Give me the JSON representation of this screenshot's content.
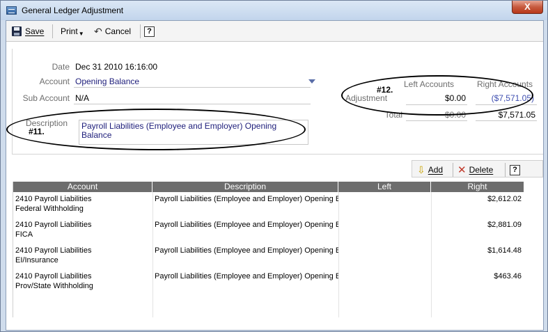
{
  "window": {
    "title": "General Ledger Adjustment",
    "close_glyph": "X"
  },
  "toolbar": {
    "save": "Save",
    "print": "Print",
    "cancel": "Cancel",
    "help": "?"
  },
  "form": {
    "date_label": "Date",
    "date_value": "Dec 31 2010 16:16:00",
    "account_label": "Account",
    "account_value": "Opening Balance",
    "sub_account_label": "Sub Account",
    "sub_account_value": "N/A",
    "description_label": "Description",
    "description_value": "Payroll Liabilities (Employee and Employer) Opening Balance",
    "annotation_11": "#11.",
    "annotation_12": "#12.",
    "left_accounts_label": "Left Accounts",
    "right_accounts_label": "Right Accounts",
    "adjustment_label": "Adjustment",
    "adjustment_left": "$0.00",
    "adjustment_right": "($7,571.05)",
    "total_label": "Total",
    "total_left": "$0.00",
    "total_right": "$7,571.05"
  },
  "grid_toolbar": {
    "add": "Add",
    "delete": "Delete",
    "help": "?"
  },
  "grid": {
    "headers": [
      "Account",
      "Description",
      "Left",
      "Right"
    ],
    "rows": [
      {
        "account_line1": "2410 Payroll Liabilities",
        "account_line2": "Federal Withholding",
        "description": "Payroll Liabilities (Employee and Employer) Opening Ba",
        "left": "",
        "right": "$2,612.02"
      },
      {
        "account_line1": "2410 Payroll Liabilities",
        "account_line2": "FICA",
        "description": "Payroll Liabilities (Employee and Employer) Opening Ba",
        "left": "",
        "right": "$2,881.09"
      },
      {
        "account_line1": "2410 Payroll Liabilities",
        "account_line2": "EI/Insurance",
        "description": "Payroll Liabilities (Employee and Employer) Opening Ba",
        "left": "",
        "right": "$1,614.48"
      },
      {
        "account_line1": "2410 Payroll Liabilities",
        "account_line2": "Prov/State Withholding",
        "description": "Payroll Liabilities (Employee and Employer) Opening Ba",
        "left": "",
        "right": "$463.46"
      }
    ]
  },
  "colors": {
    "link_blue": "#1d1d7a",
    "accent_blue": "#3f4fb0",
    "delete_red": "#c0392b"
  }
}
